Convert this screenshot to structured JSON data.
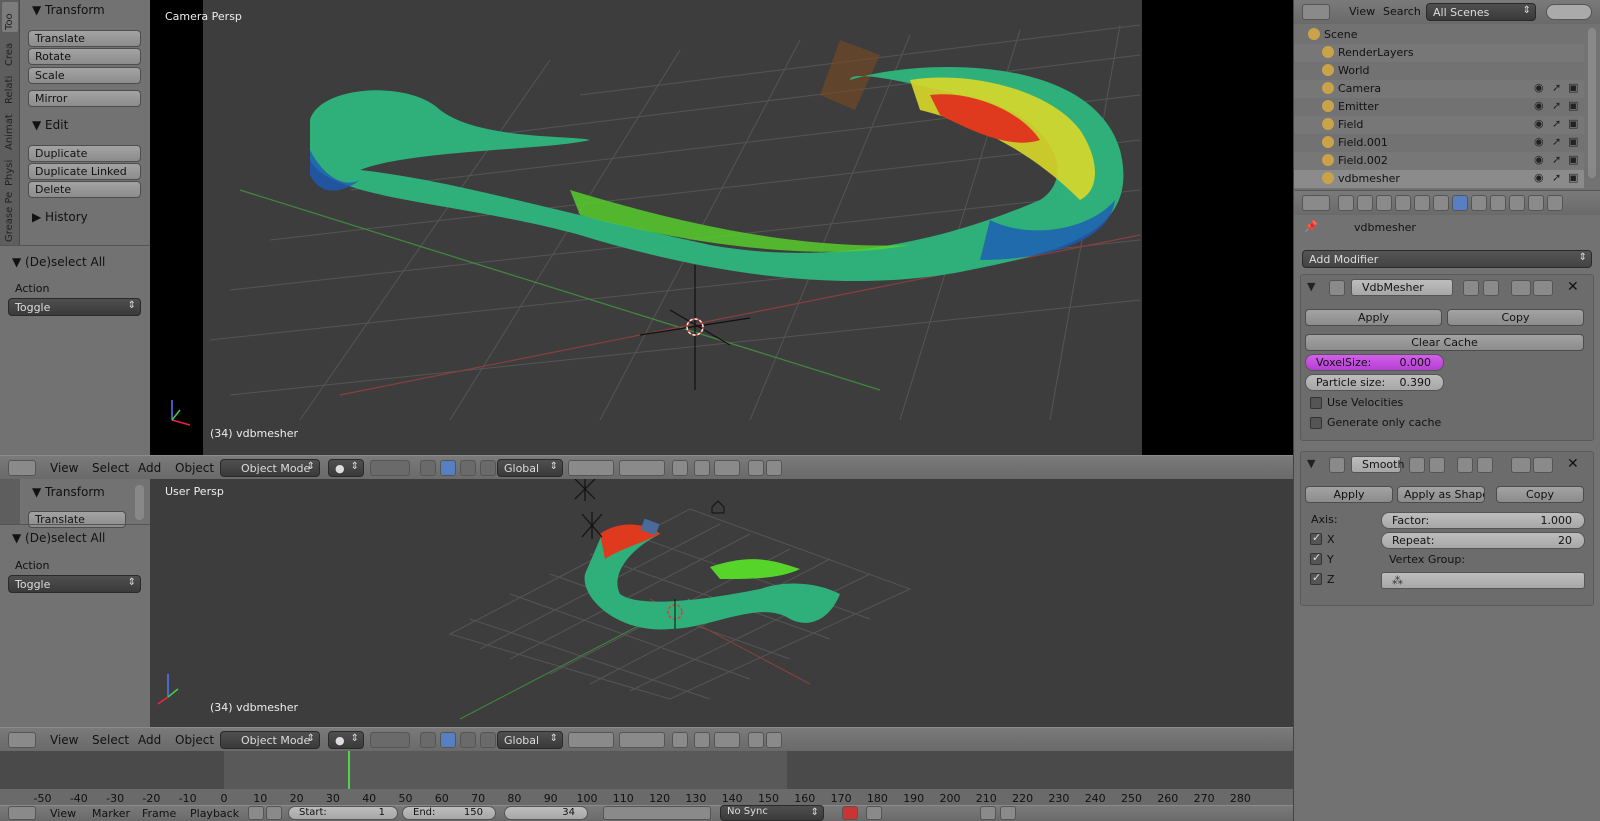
{
  "colors": {
    "bg": "#393939",
    "panel": "#727272",
    "viewport": "#3d3d3d",
    "accent_purple": "#c34ee0",
    "frame_marker": "#4ed448",
    "selected_blue": "#5680c2"
  },
  "top_viewport": {
    "label": "Camera Persp",
    "status": "(34) vdbmesher"
  },
  "bottom_viewport": {
    "label": "User Persp",
    "status": "(34) vdbmesher"
  },
  "left_tabs": [
    "Too",
    "Crea",
    "Relati",
    "Animat",
    "Physi",
    "Grease Pe"
  ],
  "tool_panel": {
    "transform_title": "Transform",
    "translate": "Translate",
    "rotate": "Rotate",
    "scale": "Scale",
    "mirror": "Mirror",
    "edit_title": "Edit",
    "duplicate": "Duplicate",
    "duplicate_linked": "Duplicate Linked",
    "delete": "Delete",
    "history_title": "History",
    "deselect_title": "(De)select All",
    "action_label": "Action",
    "action_value": "Toggle"
  },
  "tool_panel2": {
    "transform_title": "Transform",
    "translate": "Translate",
    "deselect_title": "(De)select All",
    "action_label": "Action",
    "action_value": "Toggle"
  },
  "header": {
    "view": "View",
    "select": "Select",
    "add": "Add",
    "object": "Object",
    "mode": "Object Mode",
    "orientation": "Global"
  },
  "outliner": {
    "view": "View",
    "search": "Search",
    "scenes": "All Scenes",
    "items": [
      {
        "name": "Scene"
      },
      {
        "name": "RenderLayers"
      },
      {
        "name": "World"
      },
      {
        "name": "Camera"
      },
      {
        "name": "Emitter"
      },
      {
        "name": "Field"
      },
      {
        "name": "Field.001"
      },
      {
        "name": "Field.002"
      },
      {
        "name": "vdbmesher"
      }
    ]
  },
  "properties": {
    "object_name": "vdbmesher",
    "add_modifier": "Add Modifier",
    "mod1": {
      "name": "VdbMesher",
      "apply": "Apply",
      "copy": "Copy",
      "clear_cache": "Clear Cache",
      "voxel_label": "VoxelSize:",
      "voxel_value": "0.000",
      "particle_label": "Particle size:",
      "particle_value": "0.390",
      "use_velocities": "Use Velocities",
      "gen_cache": "Generate only cache"
    },
    "mod2": {
      "name": "Smooth",
      "apply": "Apply",
      "apply_shape": "Apply as Shape ...",
      "copy": "Copy",
      "axis_label": "Axis:",
      "x": "X",
      "y": "Y",
      "z": "Z",
      "factor_label": "Factor:",
      "factor_value": "1.000",
      "repeat_label": "Repeat:",
      "repeat_value": "20",
      "vgroup_label": "Vertex Group:"
    }
  },
  "timeline": {
    "ticks": [
      "-50",
      "-40",
      "-30",
      "-20",
      "-10",
      "0",
      "10",
      "20",
      "30",
      "40",
      "50",
      "60",
      "70",
      "80",
      "90",
      "100",
      "110",
      "120",
      "130",
      "140",
      "150",
      "160",
      "170",
      "180",
      "190",
      "200",
      "210",
      "220",
      "230",
      "240",
      "250",
      "260",
      "270",
      "280"
    ],
    "current_frame": 34,
    "range_start": 0,
    "range_end": 150,
    "view": "View",
    "marker": "Marker",
    "frame": "Frame",
    "playback": "Playback",
    "start_label": "Start:",
    "start_value": "1",
    "end_label": "End:",
    "end_value": "150",
    "current": "34",
    "sync": "No Sync"
  }
}
